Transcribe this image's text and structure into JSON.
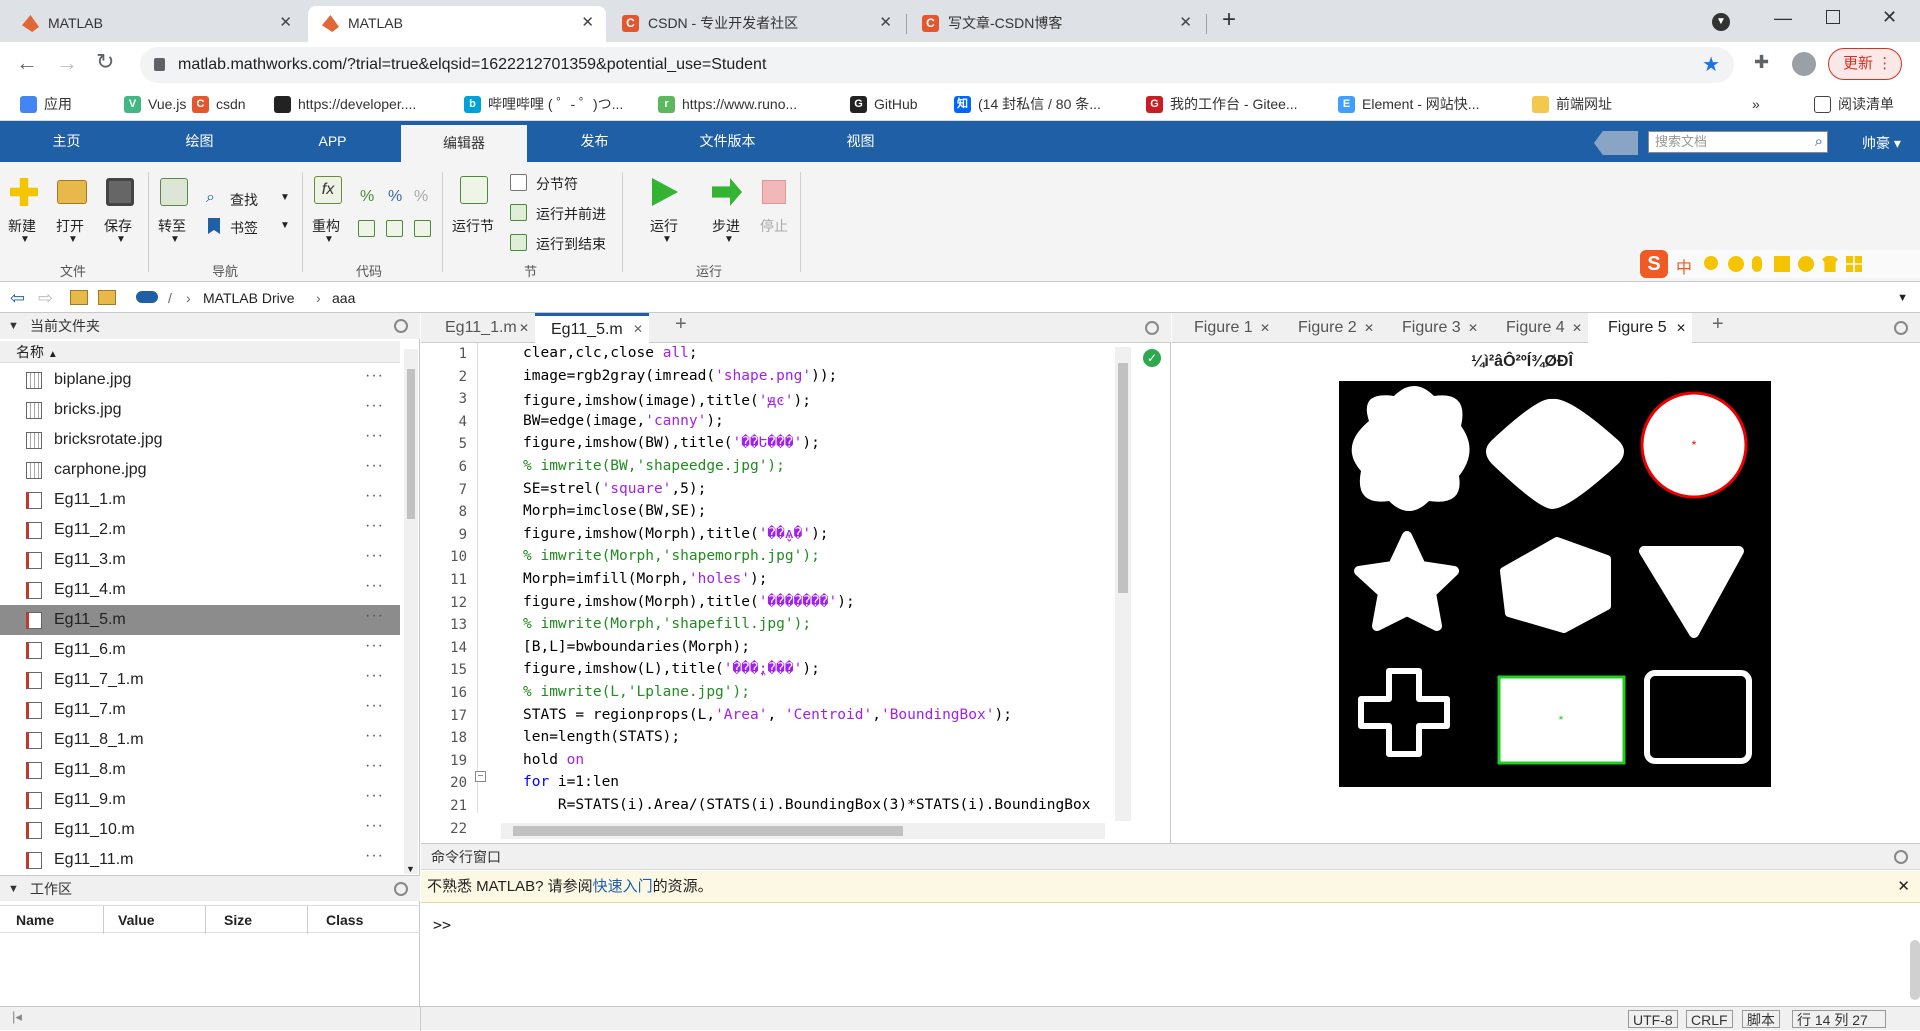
{
  "browser": {
    "tabs": [
      {
        "title": "MATLAB",
        "color": "#e16737"
      },
      {
        "title": "MATLAB",
        "color": "#e16737"
      },
      {
        "title": "CSDN - 专业开发者社区",
        "color": "#e4572e"
      },
      {
        "title": "写文章-CSDN博客",
        "color": "#e4572e"
      }
    ],
    "url": "matlab.mathworks.com/?trial=true&elqsid=1622212701359&potential_use=Student",
    "update_label": "更新",
    "bookmarks": [
      {
        "label": "应用",
        "icon": "apps-icon",
        "color": "#4285f4",
        "glyph": ""
      },
      {
        "label": "Vue.js",
        "icon": "vue-icon",
        "color": "#41b883",
        "glyph": "V"
      },
      {
        "label": "csdn",
        "icon": "csdn-icon",
        "color": "#e4572e",
        "glyph": "C"
      },
      {
        "label": "https://developer....",
        "icon": "developer-icon",
        "color": "#222222",
        "glyph": ""
      },
      {
        "label": "哔哩哔哩 ( ゜- ゜)つ...",
        "icon": "bilibili-icon",
        "color": "#00a1d6",
        "glyph": "b"
      },
      {
        "label": "https://www.runo...",
        "icon": "runoob-icon",
        "color": "#5cb85c",
        "glyph": "r"
      },
      {
        "label": "GitHub",
        "icon": "github-icon",
        "color": "#222222",
        "glyph": "G"
      },
      {
        "label": "(14 封私信 / 80 条...",
        "icon": "zhihu-icon",
        "color": "#0066ff",
        "glyph": "知"
      },
      {
        "label": "我的工作台 - Gitee...",
        "icon": "gitee-icon",
        "color": "#c71d23",
        "glyph": "G"
      },
      {
        "label": "Element - 网站快...",
        "icon": "element-icon",
        "color": "#409eff",
        "glyph": "E"
      },
      {
        "label": "前端网址",
        "icon": "folder-icon",
        "color": "#f2c94c",
        "glyph": ""
      }
    ],
    "more": "»",
    "reading_list": "阅读清单"
  },
  "matlab": {
    "tabs": [
      "主页",
      "绘图",
      "APP",
      "编辑器",
      "发布",
      "文件版本",
      "视图"
    ],
    "active_tab": "编辑器",
    "search_placeholder": "搜索文档",
    "user": "帅豪",
    "toolstrip": {
      "new": "新建",
      "open": "打开",
      "save": "保存",
      "file_group": "文件",
      "goto": "转至",
      "find": "查找",
      "bookmark": "书签",
      "nav_group": "导航",
      "refactor": "重构",
      "code_group": "代码",
      "run_section": "运行节",
      "section_break": "分节符",
      "run_advance": "运行并前进",
      "run_to_end": "运行到结束",
      "section_group": "节",
      "run": "运行",
      "step": "步进",
      "stop": "停止",
      "run_group": "运行"
    },
    "path": [
      "MATLAB Drive",
      "aaa"
    ],
    "current_folder": {
      "title": "当前文件夹",
      "col_name": "名称",
      "files": [
        "biplane.jpg",
        "bricks.jpg",
        "bricksrotate.jpg",
        "carphone.jpg",
        "Eg11_1.m",
        "Eg11_2.m",
        "Eg11_3.m",
        "Eg11_4.m",
        "Eg11_5.m",
        "Eg11_6.m",
        "Eg11_7_1.m",
        "Eg11_7.m",
        "Eg11_8_1.m",
        "Eg11_8.m",
        "Eg11_9.m",
        "Eg11_10.m",
        "Eg11_11.m"
      ],
      "selected": "Eg11_5.m",
      "more": "···"
    },
    "workspace": {
      "title": "工作区",
      "cols": [
        "Name",
        "Value",
        "Size",
        "Class"
      ]
    },
    "editor": {
      "tabs": [
        "Eg11_1.m",
        "Eg11_5.m"
      ],
      "active": "Eg11_5.m",
      "lines": [
        [
          [
            "clear,clc,close ",
            ""
          ],
          [
            "all",
            "st"
          ],
          [
            ";",
            ""
          ]
        ],
        [
          [
            "image=rgb2gray(imread(",
            ""
          ],
          [
            "'shape.png'",
            "st"
          ],
          [
            "));",
            ""
          ]
        ],
        [
          [
            "figure,imshow(image),title(",
            ""
          ],
          [
            "'ԭͼ'",
            "st"
          ],
          [
            ");",
            ""
          ]
        ],
        [
          [
            "BW=edge(image,",
            ""
          ],
          [
            "'canny'",
            "st"
          ],
          [
            ");",
            ""
          ]
        ],
        [
          [
            "figure,imshow(BW),title(",
            ""
          ],
          [
            "'��Ե���'",
            "st"
          ],
          [
            ");",
            ""
          ]
        ],
        [
          [
            "% imwrite(BW,'shapeedge.jpg');",
            "cm"
          ]
        ],
        [
          [
            "SE=strel(",
            ""
          ],
          [
            "'square'",
            "st"
          ],
          [
            ",5);",
            ""
          ]
        ],
        [
          [
            "Morph=imclose(BW,SE);",
            ""
          ]
        ],
        [
          [
            "figure,imshow(Morph),title(",
            ""
          ],
          [
            "'��̬ѧ�'",
            "st"
          ],
          [
            ");",
            ""
          ]
        ],
        [
          [
            "% imwrite(Morph,'shapemorph.jpg');",
            "cm"
          ]
        ],
        [
          [
            "Morph=imfill(Morph,",
            ""
          ],
          [
            "'holes'",
            "st"
          ],
          [
            ");",
            ""
          ]
        ],
        [
          [
            "figure,imshow(Morph),title(",
            ""
          ],
          [
            "'�������'",
            "st"
          ],
          [
            ");",
            ""
          ]
        ],
        [
          [
            "% imwrite(Morph,'shapefill.jpg');",
            "cm"
          ]
        ],
        [
          [
            "[B,L]=bwboundaries(Morph);",
            ""
          ]
        ],
        [
          [
            "figure,imshow(L),title(",
            ""
          ],
          [
            "'���ֱ;���'",
            "st"
          ],
          [
            ");",
            ""
          ]
        ],
        [
          [
            "% imwrite(L,'Lplane.jpg');",
            "cm"
          ]
        ],
        [
          [
            "STATS = regionprops(L,",
            ""
          ],
          [
            "'Area'",
            "st"
          ],
          [
            ", ",
            ""
          ],
          [
            "'Centroid'",
            "st"
          ],
          [
            ",",
            ""
          ],
          [
            "'BoundingBox'",
            "st"
          ],
          [
            ");",
            ""
          ]
        ],
        [
          [
            "len=length(STATS);",
            ""
          ]
        ],
        [
          [
            "hold ",
            ""
          ],
          [
            "on",
            "st"
          ]
        ],
        [
          [
            "for",
            "kw"
          ],
          [
            " i=1:len",
            ""
          ]
        ],
        [
          [
            "    R=STATS(i).Area/(STATS(i).BoundingBox(3)*STATS(i).BoundingBox",
            ""
          ]
        ],
        [
          [
            "    ",
            ""
          ]
        ]
      ]
    },
    "figures": {
      "tabs": [
        "Figure 1",
        "Figure 2",
        "Figure 3",
        "Figure 4",
        "Figure 5"
      ],
      "active": "Figure 5",
      "title": "¼ì²âÔ²ºÍ¾ØÐÎ"
    },
    "command": {
      "title": "命令行窗口",
      "notice_pre": "不熟悉 MATLAB? 请参阅",
      "notice_link": "快速入门",
      "notice_post": "的资源。",
      "prompt": ">>"
    },
    "status": {
      "encoding": "UTF-8",
      "eol": "CRLF",
      "type": "脚本",
      "row_label": "行",
      "row": "14",
      "col_label": "列",
      "col": "27"
    },
    "ime": {
      "label": "中"
    }
  }
}
